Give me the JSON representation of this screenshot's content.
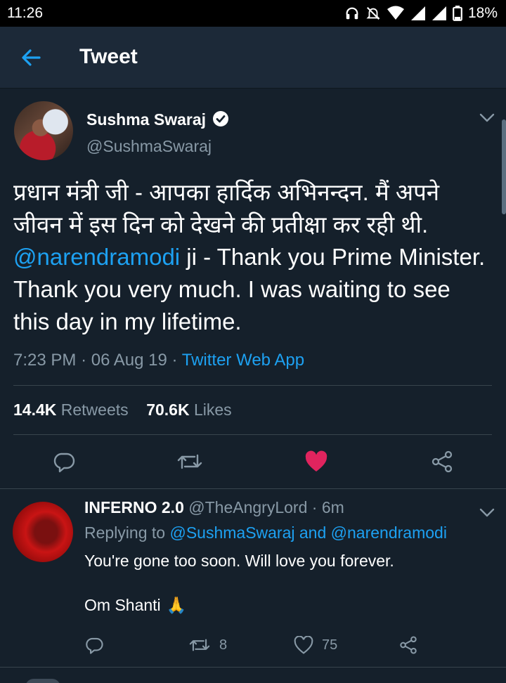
{
  "status_bar": {
    "time": "11:26",
    "battery": "18%",
    "icons": [
      "headphones-icon",
      "mute-icon",
      "wifi-icon",
      "signal-icon",
      "signal-icon",
      "battery-icon"
    ]
  },
  "header": {
    "title": "Tweet",
    "back_icon": "arrow-left-icon"
  },
  "tweet": {
    "author_name": "Sushma Swaraj",
    "author_handle": "@SushmaSwaraj",
    "verified": true,
    "text_line1": "प्रधान मंत्री जी - आपका हार्दिक अभिनन्दन. मैं अपने",
    "text_line2": "जीवन में इस दिन को देखने की प्रतीक्षा कर रही थी.",
    "mention": "@narendramodi",
    "text_rest": " ji - Thank you Prime Minister. Thank you very much. I was waiting to see this day in my lifetime.",
    "time": "7:23 PM",
    "date": "06 Aug 19",
    "sep": "·",
    "source": "Twitter Web App",
    "retweets_count": "14.4K",
    "retweets_label": "Retweets",
    "likes_count": "70.6K",
    "likes_label": "Likes",
    "liked": true
  },
  "reply": {
    "name": "INFERNO 2.0",
    "handle": "@TheAngryLord",
    "time": "· 6m",
    "replying_prefix": "Replying to",
    "replying_user1": "@SushmaSwaraj",
    "replying_and": "and",
    "replying_user2": "@narendramodi",
    "text_line1": "You're gone too soon. Will love you forever.",
    "text_line2": "Om Shanti",
    "emoji": "🙏",
    "retweets": "8",
    "likes": "75"
  },
  "colors": {
    "background": "#15202b",
    "header": "#1c2938",
    "accent": "#1da1f2",
    "muted": "#8899a6",
    "like": "#e0245e"
  }
}
